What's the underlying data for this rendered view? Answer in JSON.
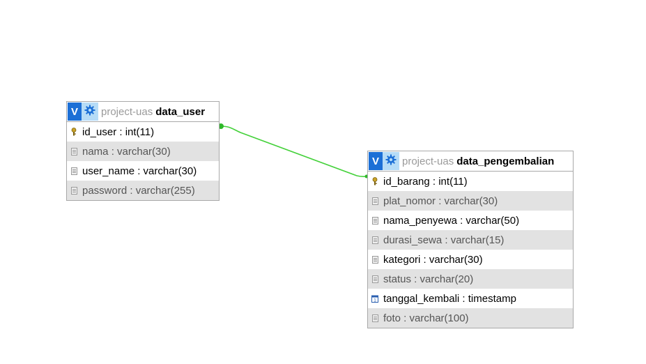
{
  "colors": {
    "relation_line": "#44d13a",
    "header_toggle": "#1c6fd6",
    "header_gear_bg": "#b6dcf7",
    "shaded_row": "#e2e2e2",
    "border": "#a9a9a9"
  },
  "tables": {
    "data_user": {
      "toggle_label": "V",
      "db_name": "project-uas",
      "table_name": "data_user",
      "columns": [
        {
          "text": "id_user : int(11)",
          "icon": "primary-key-icon"
        },
        {
          "text": "nama : varchar(30)",
          "icon": "column-icon"
        },
        {
          "text": "user_name : varchar(30)",
          "icon": "column-icon"
        },
        {
          "text": "password : varchar(255)",
          "icon": "column-icon"
        }
      ]
    },
    "data_pengembalian": {
      "toggle_label": "V",
      "db_name": "project-uas",
      "table_name": "data_pengembalian",
      "columns": [
        {
          "text": "id_barang : int(11)",
          "icon": "primary-key-icon"
        },
        {
          "text": "plat_nomor : varchar(30)",
          "icon": "column-icon"
        },
        {
          "text": "nama_penyewa : varchar(50)",
          "icon": "column-icon"
        },
        {
          "text": "durasi_sewa : varchar(15)",
          "icon": "column-icon"
        },
        {
          "text": "kategori : varchar(30)",
          "icon": "column-icon"
        },
        {
          "text": "status : varchar(20)",
          "icon": "column-icon"
        },
        {
          "text": "tanggal_kembali : timestamp",
          "icon": "timestamp-icon"
        },
        {
          "text": "foto : varchar(100)",
          "icon": "column-icon"
        }
      ]
    }
  }
}
